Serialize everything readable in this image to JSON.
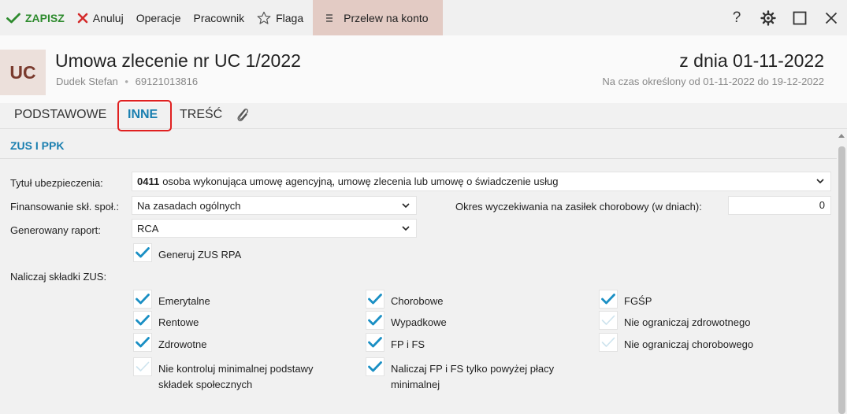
{
  "toolbar": {
    "save_label": "ZAPISZ",
    "cancel_label": "Anuluj",
    "operations_label": "Operacje",
    "employee_label": "Pracownik",
    "flag_label": "Flaga",
    "transfer_label": "Przelew na konto",
    "help_symbol": "?"
  },
  "header": {
    "avatar": "UC",
    "title": "Umowa zlecenie nr UC 1/2022",
    "person": "Dudek Stefan",
    "separator": "•",
    "pesel": "69121013816",
    "date": "z dnia 01-11-2022",
    "period": "Na czas określony od 01-11-2022 do 19-12-2022"
  },
  "tabs": {
    "basic": "PODSTAWOWE",
    "other": "INNE",
    "content": "TREŚĆ"
  },
  "section": {
    "title": "ZUS I PPK"
  },
  "form": {
    "insurance_label": "Tytuł ubezpieczenia:",
    "insurance_code": "0411",
    "insurance_text": "osoba wykonująca umowę agencyjną, umowę zlecenia lub umowę o świadczenie usług",
    "financing_label": "Finansowanie skł. społ.:",
    "financing_value": "Na zasadach ogólnych",
    "waiting_label": "Okres wyczekiwania na zasiłek chorobowy (w dniach):",
    "waiting_value": "0",
    "report_label": "Generowany raport:",
    "report_value": "RCA",
    "rpa_label": "Generuj ZUS RPA",
    "contributions_label": "Naliczaj składki ZUS:"
  },
  "checks": {
    "pension": "Emerytalne",
    "disability": "Rentowe",
    "health": "Zdrowotne",
    "no_min_base_1": "Nie kontroluj minimalnej podstawy",
    "no_min_base_2": "składek społecznych",
    "sickness": "Chorobowe",
    "accident": "Wypadkowe",
    "fp_fs": "FP i FS",
    "fp_fs_above_1": "Naliczaj FP i FS tylko powyżej płacy",
    "fp_fs_above_2": "minimalnej",
    "fgsp": "FGŚP",
    "no_limit_health": "Nie ograniczaj zdrowotnego",
    "no_limit_sickness": "Nie ograniczaj chorobowego"
  },
  "colors": {
    "accent": "#1a7fb0",
    "save_green": "#2e8b2e",
    "cancel_red": "#d42a2a",
    "avatar_bg": "#ece0db",
    "avatar_fg": "#7a3b2e",
    "transfer_bg": "#e3cbc4",
    "highlight_frame": "#e02020"
  },
  "icons": {
    "save": "check-icon",
    "cancel": "x-icon",
    "flag": "star-icon",
    "transfer": "menu-icon",
    "help": "question-icon",
    "settings": "gear-icon",
    "maximize": "square-icon",
    "close": "close-icon",
    "attachment": "paperclip-icon"
  }
}
